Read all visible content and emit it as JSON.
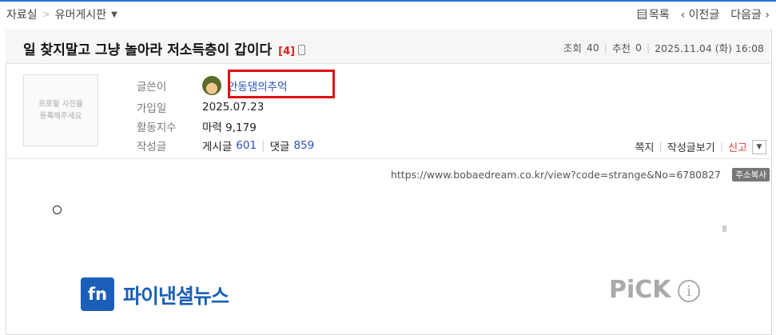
{
  "breadcrumb": {
    "section": "자료실",
    "separator": ">",
    "board": "유머게시판"
  },
  "topnav": {
    "list": "목록",
    "prev": "‹ 이전글",
    "next": "다음글 ›"
  },
  "post": {
    "title": "일 찾지말고 그냥 놀아라 저소득층이 갑이다",
    "comment_count": "[4]",
    "views_label": "조회",
    "views": "40",
    "recommend_label": "추천",
    "recommend": "0",
    "datetime": "2025.11.04 (화) 16:08"
  },
  "profile": {
    "photo_placeholder": "프로필 사진을\n등록해주세요",
    "author_label": "글쓴이",
    "author": "안동댐의추억",
    "joined_label": "가입일",
    "joined": "2025.07.23",
    "activity_label": "활동지수",
    "activity": "마력 9,179",
    "posts_label": "작성글",
    "posts_prefix": "게시글",
    "posts_count": "601",
    "comments_prefix": "댓글",
    "comments_count": "859"
  },
  "actions": {
    "message": "쪽지",
    "view_posts": "작성글보기",
    "report": "신고",
    "dropdown_icon": "triangle-down"
  },
  "url": {
    "text": "https://www.bobaedream.co.kr/view?code=strange&No=6780827",
    "copy_label": "주소복사"
  },
  "content": {
    "bullet": "○",
    "fn_logo_text": "fn",
    "brand_text": "파이낸셜뉴스",
    "pick_text": "PiCK",
    "info_icon": "info-circle-icon"
  },
  "colors": {
    "accent": "#2a6fd6",
    "highlight": "#e01010",
    "brand": "#1b5fb8",
    "link": "#2a4fb6"
  }
}
